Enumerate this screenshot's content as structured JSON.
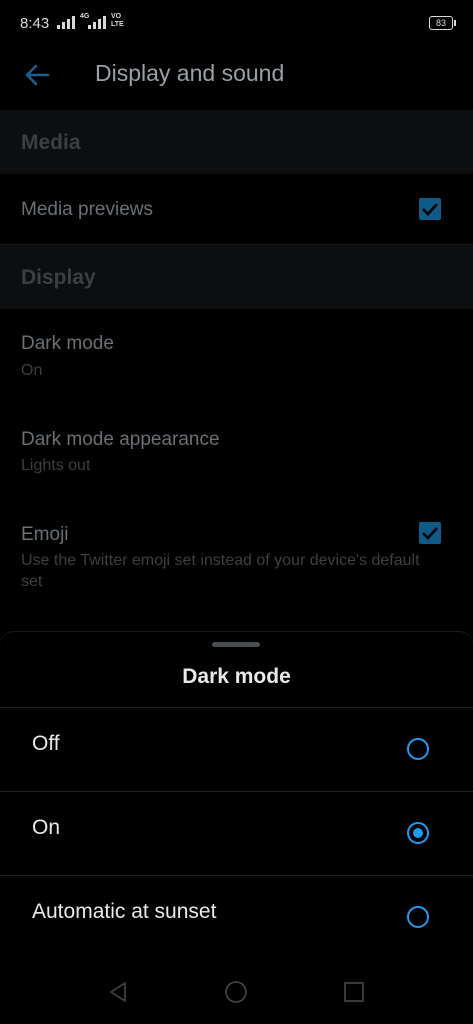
{
  "status_bar": {
    "time": "8:43",
    "network_4g": "4G",
    "volte_top": "VO",
    "volte_bottom": "LTE",
    "battery": "83"
  },
  "header": {
    "title": "Display and sound"
  },
  "sections": {
    "media": {
      "heading": "Media",
      "media_previews": {
        "label": "Media previews",
        "checked": true
      }
    },
    "display": {
      "heading": "Display",
      "dark_mode": {
        "label": "Dark mode",
        "value": "On"
      },
      "dark_mode_appearance": {
        "label": "Dark mode appearance",
        "value": "Lights out"
      },
      "emoji": {
        "label": "Emoji",
        "description": "Use the Twitter emoji set instead of your device's default set",
        "checked": true
      }
    }
  },
  "sheet": {
    "title": "Dark mode",
    "options": [
      {
        "label": "Off",
        "selected": false
      },
      {
        "label": "On",
        "selected": true
      },
      {
        "label": "Automatic at sunset",
        "selected": false
      }
    ]
  },
  "colors": {
    "accent": "#1d9bf0",
    "checkbox": "#0e5b8a"
  }
}
